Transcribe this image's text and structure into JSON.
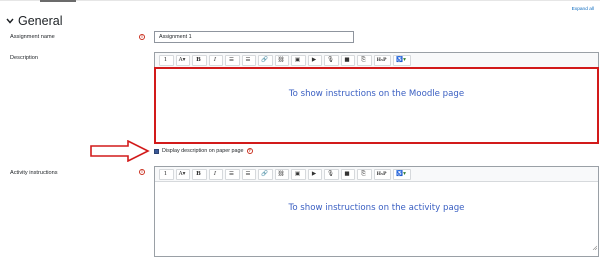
{
  "header": {
    "expand_all": "Expand all",
    "section_title": "General"
  },
  "fields": {
    "assignment_name_label": "Assignment name",
    "assignment_name_value": "Assignment 1",
    "description_label": "Description",
    "activity_label": "Activity instructions"
  },
  "description_editor": {
    "content": "To show instructions on the Moodle page"
  },
  "activity_editor": {
    "content": "To show instructions on the activity page"
  },
  "checkbox": {
    "label": "Display description on paper page"
  },
  "toolbar": {
    "para": "1",
    "font": "A▾",
    "bold": "B",
    "italic": "I",
    "unordered_list": "☰",
    "ordered_list": "☰",
    "link": "🔗",
    "unlink": "⛓",
    "image": "▣",
    "media": "▶",
    "record_audio": "🎙",
    "record_video": "■",
    "manage_files": "⎘",
    "h5p": "H₅P",
    "accessibility": "♿▾"
  },
  "colors": {
    "accent": "#0f6cbf",
    "required": "#ca3120",
    "annotation": "#d21a1a",
    "instruction_text": "#3a5fc2"
  },
  "icons": {
    "section": "chevron-down-icon",
    "required": "required-icon",
    "help": "help-icon",
    "arrow": "red-arrow-icon"
  }
}
